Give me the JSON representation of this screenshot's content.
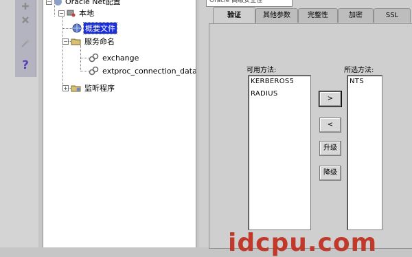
{
  "title_field": "Oracle 高级安全性",
  "tree": {
    "root": "Oracle Net配置",
    "local": "本地",
    "profile": "概要文件",
    "service_naming": "服务命名",
    "services": [
      "exchange",
      "extproc_connection_data"
    ],
    "listeners": "监听程序"
  },
  "tabs": [
    "验证",
    "其他参数",
    "完整性",
    "加密",
    "SSL"
  ],
  "available_label": "可用方法:",
  "selected_label": "所选方法:",
  "available_methods": [
    "KERBEROS5",
    "RADIUS"
  ],
  "selected_methods": [
    "NTS"
  ],
  "buttons": {
    "add": ">",
    "remove": "<",
    "promote": "升级",
    "demote": "降级"
  },
  "watermark": "idcpu.com",
  "colors": {
    "selection": "#1a2fd8",
    "watermark": "#c0392b",
    "help_icon": "#5a3fb8"
  },
  "icons": [
    "plus-icon",
    "delete-x-icon",
    "wizard-wand-icon",
    "help-question-icon"
  ]
}
